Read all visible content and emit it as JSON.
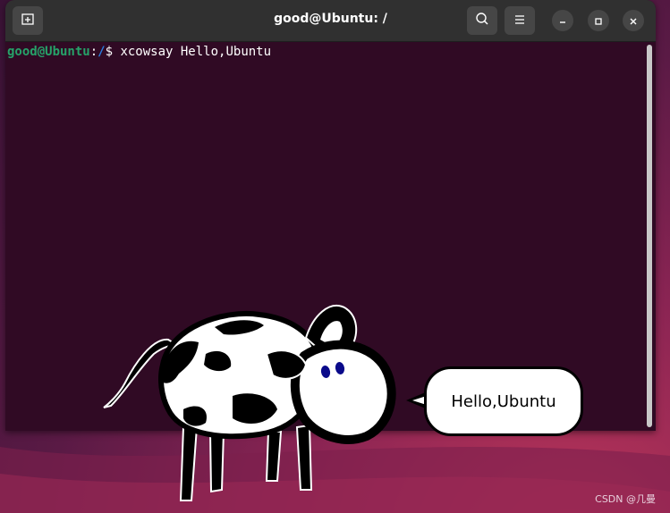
{
  "window": {
    "title": "good@Ubuntu: /"
  },
  "terminal": {
    "prompt_user": "good@Ubuntu",
    "prompt_sep": ":",
    "prompt_path": "/",
    "prompt_symbol": "$ ",
    "command": "xcowsay Hello,Ubuntu"
  },
  "cow_bubble": {
    "text": "Hello,Ubuntu"
  },
  "watermark": {
    "text": "CSDN @几曼"
  },
  "icons": {
    "new_tab": "new-tab-icon",
    "search": "search-icon",
    "menu": "hamburger-menu-icon",
    "minimize": "minimize-icon",
    "maximize": "maximize-icon",
    "close": "close-icon"
  },
  "colors": {
    "terminal_bg": "#300a24",
    "titlebar_bg": "#303030",
    "prompt_user": "#26a269",
    "prompt_path": "#2a7bde"
  }
}
